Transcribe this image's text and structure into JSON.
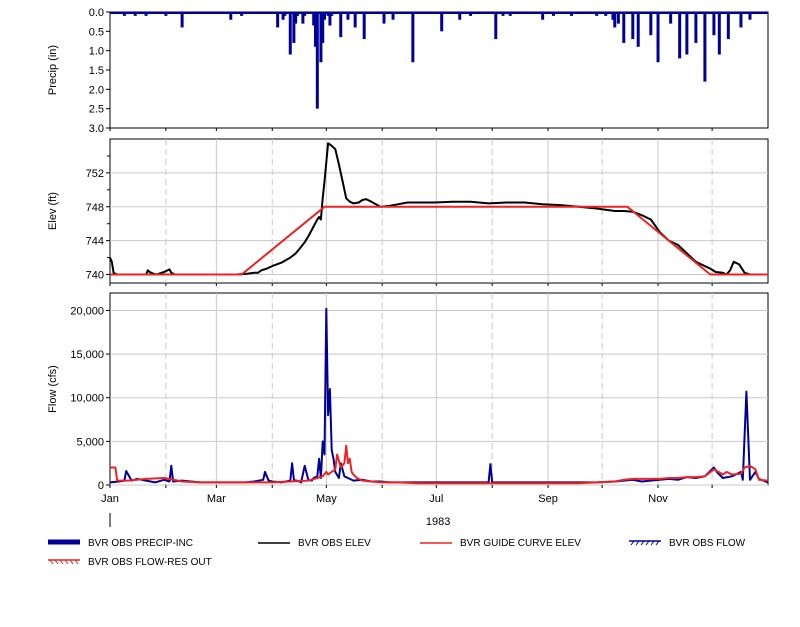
{
  "chart_data": [
    {
      "type": "bar",
      "ylabel": "Precip (in)",
      "ylim": [
        3.0,
        0.0
      ],
      "inverted": true,
      "yticks": [
        "0.0",
        "0.5",
        "1.0",
        "1.5",
        "2.0",
        "2.5",
        "3.0"
      ],
      "ytick_values": [
        0,
        0.5,
        1.0,
        1.5,
        2.0,
        2.5,
        3.0
      ],
      "grid": false,
      "series": [
        {
          "name": "BVR OBS PRECIP-INC",
          "color": "#000099",
          "x_day": [
            8,
            10,
            14,
            16,
            20,
            22,
            31,
            33,
            40,
            67,
            73,
            93,
            96,
            97,
            100,
            102,
            103,
            104,
            107,
            108,
            113,
            114,
            115,
            117,
            118,
            119,
            121,
            122,
            123,
            128,
            132,
            136,
            141,
            152,
            157,
            168,
            184,
            194,
            200,
            214,
            218,
            222,
            240,
            246,
            256,
            270,
            275,
            279,
            280,
            282,
            285,
            290,
            293,
            300,
            304,
            311,
            316,
            320,
            325,
            330,
            335,
            338,
            343,
            350,
            355,
            360
          ],
          "values": [
            0.1,
            0.05,
            0.1,
            0.05,
            0.1,
            0.05,
            0.1,
            0.05,
            0.4,
            0.2,
            0.1,
            0.4,
            0.2,
            0.1,
            1.1,
            0.8,
            0.3,
            0.1,
            0.3,
            0.1,
            0.35,
            0.9,
            2.5,
            1.3,
            0.8,
            0.2,
            0.1,
            0.35,
            0.1,
            0.65,
            0.2,
            0.4,
            0.7,
            0.3,
            0.2,
            1.3,
            0.5,
            0.2,
            0.1,
            0.7,
            0.1,
            0.1,
            0.2,
            0.1,
            0.1,
            0.1,
            0.1,
            0.2,
            0.4,
            0.3,
            0.8,
            0.7,
            0.9,
            0.6,
            1.3,
            0.3,
            1.2,
            1.1,
            0.8,
            1.8,
            0.6,
            1.1,
            0.7,
            0.4,
            0.2,
            0.05
          ]
        }
      ]
    },
    {
      "type": "line",
      "ylabel": "Elev (ft)",
      "ylim": [
        739,
        756
      ],
      "yticks": [
        "740",
        "744",
        "748",
        "752"
      ],
      "ytick_values": [
        740,
        744,
        748,
        752
      ],
      "grid": true,
      "series": [
        {
          "name": "BVR OBS ELEV",
          "color": "#000000",
          "x_day": [
            0,
            1,
            2,
            4,
            6,
            10,
            20,
            21,
            22,
            24,
            26,
            30,
            33,
            34,
            36,
            40,
            50,
            60,
            70,
            76,
            80,
            82,
            84,
            87,
            90,
            95,
            100,
            103,
            105,
            108,
            110,
            115,
            116,
            117,
            118,
            119,
            121,
            123,
            125,
            127,
            129,
            130,
            131,
            133,
            135,
            138,
            140,
            142,
            145,
            150,
            155,
            160,
            165,
            170,
            180,
            190,
            200,
            210,
            220,
            230,
            240,
            250,
            260,
            270,
            280,
            285,
            290,
            295,
            300,
            305,
            310,
            315,
            320,
            325,
            330,
            333,
            336,
            340,
            342,
            344,
            346,
            349,
            352,
            355,
            360,
            365
          ],
          "values": [
            742,
            741.5,
            740.2,
            740,
            740,
            740,
            740,
            740.5,
            740.3,
            740.1,
            740,
            740.3,
            740.6,
            740.2,
            740,
            740,
            740,
            740,
            740,
            740.1,
            740.2,
            740.2,
            740.5,
            740.7,
            741,
            741.4,
            742,
            742.5,
            743,
            743.8,
            744.5,
            746.5,
            746.8,
            746.5,
            749,
            751,
            755.5,
            755.2,
            754.8,
            753,
            751,
            750,
            749,
            748.6,
            748.4,
            748.5,
            748.8,
            748.9,
            748.6,
            748,
            748.1,
            748.3,
            748.5,
            748.5,
            748.5,
            748.6,
            748.6,
            748.4,
            748.5,
            748.5,
            748.3,
            748.2,
            748,
            747.8,
            747.5,
            747.5,
            747.4,
            747,
            746.5,
            745,
            744,
            743.5,
            742.5,
            741.5,
            741,
            740.7,
            740.3,
            740.2,
            740,
            740.5,
            741.5,
            741.2,
            740.2,
            740,
            740,
            740
          ]
        },
        {
          "name": "BVR GUIDE CURVE ELEV",
          "color": "#ee2222",
          "x_day": [
            0,
            73,
            119,
            287,
            333,
            365
          ],
          "values": [
            740,
            740,
            748,
            748,
            740,
            740
          ]
        }
      ]
    },
    {
      "type": "line",
      "ylabel": "Flow (cfs)",
      "ylim": [
        0,
        22000
      ],
      "yticks": [
        "0",
        "5,000",
        "10,000",
        "15,000",
        "20,000"
      ],
      "ytick_values": [
        0,
        5000,
        10000,
        15000,
        20000
      ],
      "grid": true,
      "xticks": [
        "Jan",
        "Mar",
        "May",
        "Jul",
        "Sep",
        "Nov"
      ],
      "xtick_days": [
        0,
        59,
        120,
        181,
        243,
        304
      ],
      "xlabel": "1983",
      "series": [
        {
          "name": "BVR OBS FLOW",
          "color": "#000099",
          "x_day": [
            0,
            5,
            8,
            9,
            12,
            15,
            20,
            25,
            30,
            33,
            34,
            35,
            40,
            50,
            60,
            70,
            75,
            80,
            85,
            86,
            88,
            90,
            95,
            100,
            101,
            102,
            105,
            106,
            108,
            110,
            112,
            113,
            115,
            116,
            117,
            118,
            119,
            120,
            121,
            122,
            123,
            124,
            125,
            127,
            128,
            130,
            133,
            135,
            140,
            145,
            150,
            155,
            160,
            170,
            180,
            190,
            200,
            210,
            211,
            212,
            220,
            230,
            240,
            250,
            260,
            270,
            280,
            285,
            290,
            295,
            300,
            305,
            310,
            315,
            320,
            325,
            330,
            335,
            337,
            340,
            345,
            350,
            351,
            353,
            355,
            358,
            360,
            365
          ],
          "values": [
            300,
            400,
            500,
            1600,
            500,
            700,
            500,
            300,
            600,
            400,
            2200,
            400,
            500,
            300,
            300,
            300,
            300,
            400,
            600,
            1500,
            500,
            400,
            300,
            500,
            2500,
            600,
            400,
            300,
            2200,
            600,
            500,
            800,
            1000,
            3000,
            800,
            5000,
            3500,
            20200,
            8000,
            11000,
            4000,
            3000,
            1500,
            800,
            2500,
            1000,
            700,
            500,
            600,
            400,
            400,
            300,
            300,
            300,
            300,
            300,
            300,
            300,
            2400,
            300,
            300,
            300,
            300,
            300,
            300,
            300,
            400,
            500,
            600,
            400,
            500,
            600,
            700,
            600,
            900,
            800,
            1000,
            2000,
            1400,
            800,
            1000,
            1500,
            600,
            10700,
            600,
            1500,
            700,
            300
          ]
        },
        {
          "name": "BVR OBS FLOW-RES OUT",
          "color": "#ee2222",
          "x_day": [
            0,
            3,
            4,
            10,
            20,
            30,
            40,
            50,
            60,
            70,
            80,
            90,
            100,
            110,
            115,
            118,
            120,
            121,
            125,
            126,
            128,
            130,
            131,
            132,
            133,
            134,
            135,
            136,
            137,
            138,
            140,
            145,
            150,
            160,
            170,
            180,
            190,
            200,
            210,
            220,
            230,
            240,
            250,
            260,
            270,
            280,
            285,
            290,
            295,
            300,
            305,
            310,
            315,
            320,
            325,
            330,
            335,
            340,
            342,
            345,
            350,
            352,
            355,
            358,
            360,
            365
          ],
          "values": [
            2000,
            2000,
            500,
            500,
            700,
            800,
            400,
            300,
            300,
            300,
            300,
            300,
            400,
            500,
            800,
            1000,
            1500,
            1200,
            1800,
            3500,
            2000,
            2500,
            4500,
            2500,
            3000,
            1500,
            1200,
            1000,
            800,
            700,
            500,
            400,
            300,
            300,
            200,
            200,
            200,
            200,
            200,
            200,
            200,
            200,
            200,
            200,
            300,
            400,
            600,
            700,
            700,
            700,
            700,
            800,
            800,
            900,
            900,
            1000,
            1800,
            1200,
            1500,
            1200,
            1300,
            2000,
            2200,
            1800,
            600,
            500
          ]
        }
      ]
    }
  ],
  "legend": {
    "items": [
      {
        "label": "BVR OBS PRECIP-INC",
        "color": "#000099",
        "style": "thick-bar"
      },
      {
        "label": "BVR OBS ELEV",
        "color": "#000000",
        "style": "line"
      },
      {
        "label": "BVR GUIDE CURVE ELEV",
        "color": "#ee2222",
        "style": "line"
      },
      {
        "label": "BVR OBS FLOW",
        "color": "#000099",
        "style": "hatch"
      },
      {
        "label": "BVR OBS FLOW-RES OUT",
        "color": "#ee2222",
        "style": "hatch"
      }
    ]
  }
}
